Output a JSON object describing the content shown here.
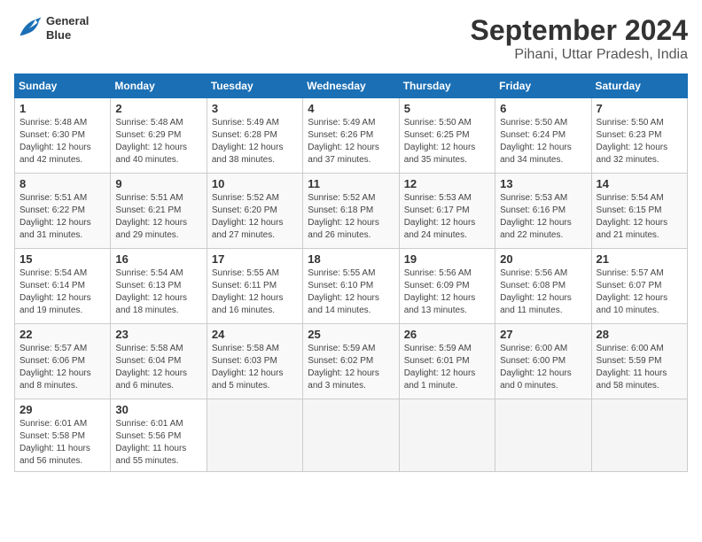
{
  "header": {
    "logo_line1": "General",
    "logo_line2": "Blue",
    "month_year": "September 2024",
    "location": "Pihani, Uttar Pradesh, India"
  },
  "weekdays": [
    "Sunday",
    "Monday",
    "Tuesday",
    "Wednesday",
    "Thursday",
    "Friday",
    "Saturday"
  ],
  "weeks": [
    [
      {
        "day": "1",
        "sunrise": "Sunrise: 5:48 AM",
        "sunset": "Sunset: 6:30 PM",
        "daylight": "Daylight: 12 hours and 42 minutes."
      },
      {
        "day": "2",
        "sunrise": "Sunrise: 5:48 AM",
        "sunset": "Sunset: 6:29 PM",
        "daylight": "Daylight: 12 hours and 40 minutes."
      },
      {
        "day": "3",
        "sunrise": "Sunrise: 5:49 AM",
        "sunset": "Sunset: 6:28 PM",
        "daylight": "Daylight: 12 hours and 38 minutes."
      },
      {
        "day": "4",
        "sunrise": "Sunrise: 5:49 AM",
        "sunset": "Sunset: 6:26 PM",
        "daylight": "Daylight: 12 hours and 37 minutes."
      },
      {
        "day": "5",
        "sunrise": "Sunrise: 5:50 AM",
        "sunset": "Sunset: 6:25 PM",
        "daylight": "Daylight: 12 hours and 35 minutes."
      },
      {
        "day": "6",
        "sunrise": "Sunrise: 5:50 AM",
        "sunset": "Sunset: 6:24 PM",
        "daylight": "Daylight: 12 hours and 34 minutes."
      },
      {
        "day": "7",
        "sunrise": "Sunrise: 5:50 AM",
        "sunset": "Sunset: 6:23 PM",
        "daylight": "Daylight: 12 hours and 32 minutes."
      }
    ],
    [
      {
        "day": "8",
        "sunrise": "Sunrise: 5:51 AM",
        "sunset": "Sunset: 6:22 PM",
        "daylight": "Daylight: 12 hours and 31 minutes."
      },
      {
        "day": "9",
        "sunrise": "Sunrise: 5:51 AM",
        "sunset": "Sunset: 6:21 PM",
        "daylight": "Daylight: 12 hours and 29 minutes."
      },
      {
        "day": "10",
        "sunrise": "Sunrise: 5:52 AM",
        "sunset": "Sunset: 6:20 PM",
        "daylight": "Daylight: 12 hours and 27 minutes."
      },
      {
        "day": "11",
        "sunrise": "Sunrise: 5:52 AM",
        "sunset": "Sunset: 6:18 PM",
        "daylight": "Daylight: 12 hours and 26 minutes."
      },
      {
        "day": "12",
        "sunrise": "Sunrise: 5:53 AM",
        "sunset": "Sunset: 6:17 PM",
        "daylight": "Daylight: 12 hours and 24 minutes."
      },
      {
        "day": "13",
        "sunrise": "Sunrise: 5:53 AM",
        "sunset": "Sunset: 6:16 PM",
        "daylight": "Daylight: 12 hours and 22 minutes."
      },
      {
        "day": "14",
        "sunrise": "Sunrise: 5:54 AM",
        "sunset": "Sunset: 6:15 PM",
        "daylight": "Daylight: 12 hours and 21 minutes."
      }
    ],
    [
      {
        "day": "15",
        "sunrise": "Sunrise: 5:54 AM",
        "sunset": "Sunset: 6:14 PM",
        "daylight": "Daylight: 12 hours and 19 minutes."
      },
      {
        "day": "16",
        "sunrise": "Sunrise: 5:54 AM",
        "sunset": "Sunset: 6:13 PM",
        "daylight": "Daylight: 12 hours and 18 minutes."
      },
      {
        "day": "17",
        "sunrise": "Sunrise: 5:55 AM",
        "sunset": "Sunset: 6:11 PM",
        "daylight": "Daylight: 12 hours and 16 minutes."
      },
      {
        "day": "18",
        "sunrise": "Sunrise: 5:55 AM",
        "sunset": "Sunset: 6:10 PM",
        "daylight": "Daylight: 12 hours and 14 minutes."
      },
      {
        "day": "19",
        "sunrise": "Sunrise: 5:56 AM",
        "sunset": "Sunset: 6:09 PM",
        "daylight": "Daylight: 12 hours and 13 minutes."
      },
      {
        "day": "20",
        "sunrise": "Sunrise: 5:56 AM",
        "sunset": "Sunset: 6:08 PM",
        "daylight": "Daylight: 12 hours and 11 minutes."
      },
      {
        "day": "21",
        "sunrise": "Sunrise: 5:57 AM",
        "sunset": "Sunset: 6:07 PM",
        "daylight": "Daylight: 12 hours and 10 minutes."
      }
    ],
    [
      {
        "day": "22",
        "sunrise": "Sunrise: 5:57 AM",
        "sunset": "Sunset: 6:06 PM",
        "daylight": "Daylight: 12 hours and 8 minutes."
      },
      {
        "day": "23",
        "sunrise": "Sunrise: 5:58 AM",
        "sunset": "Sunset: 6:04 PM",
        "daylight": "Daylight: 12 hours and 6 minutes."
      },
      {
        "day": "24",
        "sunrise": "Sunrise: 5:58 AM",
        "sunset": "Sunset: 6:03 PM",
        "daylight": "Daylight: 12 hours and 5 minutes."
      },
      {
        "day": "25",
        "sunrise": "Sunrise: 5:59 AM",
        "sunset": "Sunset: 6:02 PM",
        "daylight": "Daylight: 12 hours and 3 minutes."
      },
      {
        "day": "26",
        "sunrise": "Sunrise: 5:59 AM",
        "sunset": "Sunset: 6:01 PM",
        "daylight": "Daylight: 12 hours and 1 minute."
      },
      {
        "day": "27",
        "sunrise": "Sunrise: 6:00 AM",
        "sunset": "Sunset: 6:00 PM",
        "daylight": "Daylight: 12 hours and 0 minutes."
      },
      {
        "day": "28",
        "sunrise": "Sunrise: 6:00 AM",
        "sunset": "Sunset: 5:59 PM",
        "daylight": "Daylight: 11 hours and 58 minutes."
      }
    ],
    [
      {
        "day": "29",
        "sunrise": "Sunrise: 6:01 AM",
        "sunset": "Sunset: 5:58 PM",
        "daylight": "Daylight: 11 hours and 56 minutes."
      },
      {
        "day": "30",
        "sunrise": "Sunrise: 6:01 AM",
        "sunset": "Sunset: 5:56 PM",
        "daylight": "Daylight: 11 hours and 55 minutes."
      },
      {
        "day": "",
        "sunrise": "",
        "sunset": "",
        "daylight": ""
      },
      {
        "day": "",
        "sunrise": "",
        "sunset": "",
        "daylight": ""
      },
      {
        "day": "",
        "sunrise": "",
        "sunset": "",
        "daylight": ""
      },
      {
        "day": "",
        "sunrise": "",
        "sunset": "",
        "daylight": ""
      },
      {
        "day": "",
        "sunrise": "",
        "sunset": "",
        "daylight": ""
      }
    ]
  ]
}
